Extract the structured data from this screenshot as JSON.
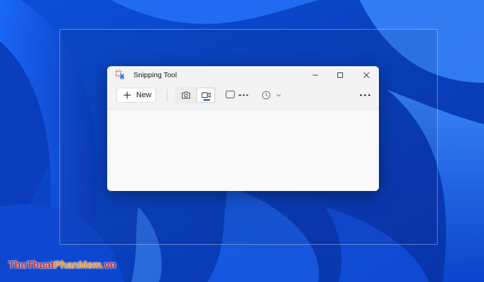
{
  "window": {
    "title": "Snipping Tool"
  },
  "toolbar": {
    "new_label": "New",
    "modes": [
      {
        "name": "screenshot",
        "icon": "camera-icon",
        "selected": false
      },
      {
        "name": "record",
        "icon": "video-camera-icon",
        "selected": true
      }
    ],
    "snip_shape": {
      "icon": "rectangle-snip-icon"
    },
    "delay": {
      "icon": "clock-icon"
    },
    "more": {
      "icon": "more-options-icon"
    }
  },
  "watermark": {
    "part1": "ThuThuat",
    "part2": "PhanMem",
    "part3": ".vn"
  },
  "colors": {
    "accent": "#005fb8",
    "wallpaper": "#0a3fc4",
    "window_bg": "#f9f9f9"
  }
}
